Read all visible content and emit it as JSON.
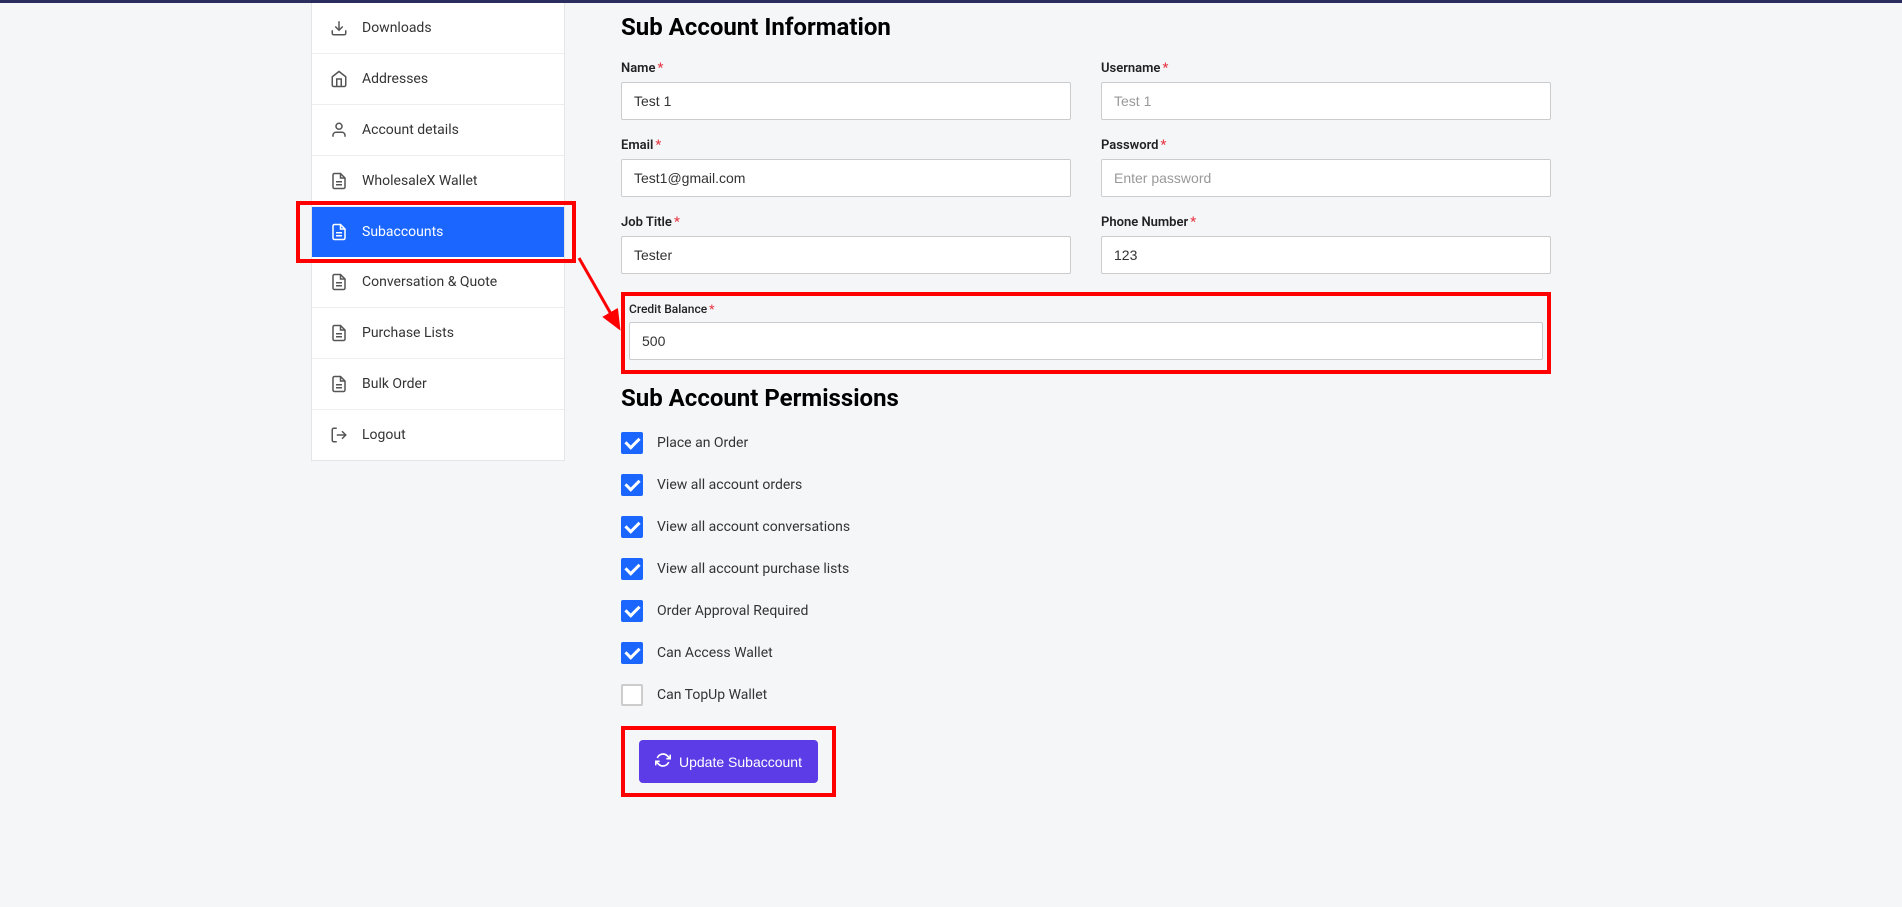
{
  "sidebar": {
    "items": [
      {
        "label": "Downloads"
      },
      {
        "label": "Addresses"
      },
      {
        "label": "Account details"
      },
      {
        "label": "WholesaleX Wallet"
      },
      {
        "label": "Subaccounts"
      },
      {
        "label": "Conversation & Quote"
      },
      {
        "label": "Purchase Lists"
      },
      {
        "label": "Bulk Order"
      },
      {
        "label": "Logout"
      }
    ]
  },
  "main": {
    "section1_title": "Sub Account Information",
    "section2_title": "Sub Account Permissions",
    "fields": {
      "name": {
        "label": "Name",
        "value": "Test 1"
      },
      "username": {
        "label": "Username",
        "placeholder": "Test 1",
        "value": ""
      },
      "email": {
        "label": "Email",
        "value": "Test1@gmail.com"
      },
      "password": {
        "label": "Password",
        "placeholder": "Enter password",
        "value": ""
      },
      "job_title": {
        "label": "Job Title",
        "value": "Tester"
      },
      "phone": {
        "label": "Phone Number",
        "value": "123"
      },
      "credit": {
        "label": "Credit Balance",
        "value": "500"
      }
    },
    "permissions": [
      {
        "label": "Place an Order",
        "checked": true
      },
      {
        "label": "View all account orders",
        "checked": true
      },
      {
        "label": "View all account conversations",
        "checked": true
      },
      {
        "label": "View all account purchase lists",
        "checked": true
      },
      {
        "label": "Order Approval Required",
        "checked": true
      },
      {
        "label": "Can Access Wallet",
        "checked": true
      },
      {
        "label": "Can TopUp Wallet",
        "checked": false
      }
    ],
    "button": "Update Subaccount"
  }
}
